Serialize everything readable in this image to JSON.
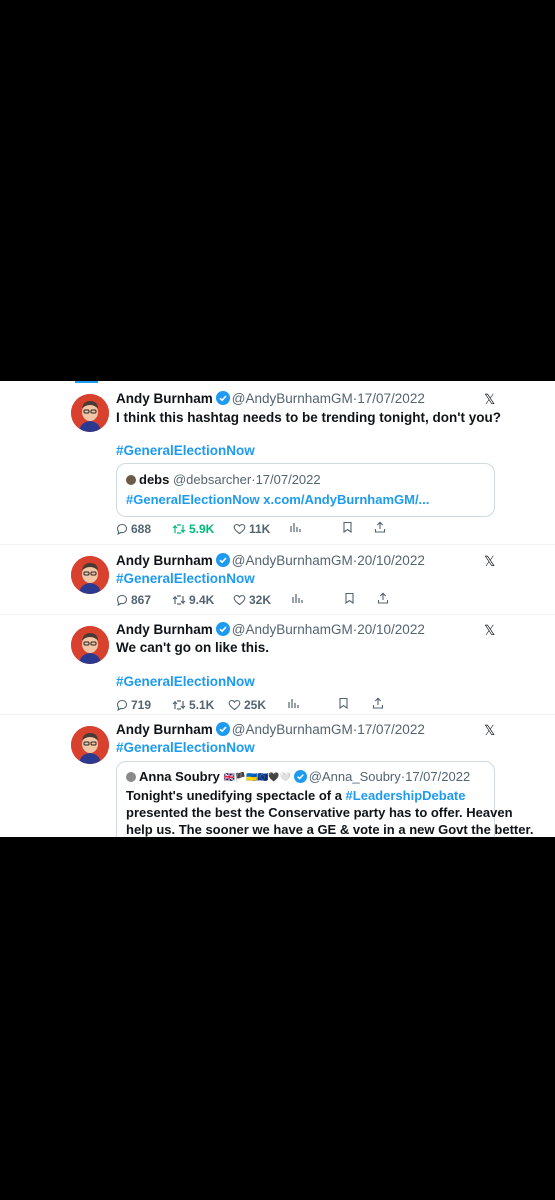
{
  "colors": {
    "accent": "#1d9bf0",
    "retweet_green": "#00ba7c",
    "avatar_bg": "#d9412f"
  },
  "tweets": [
    {
      "author_name": "Andy Burnham",
      "author_handle": "@AndyBurnhamGM",
      "date": "17/07/2022",
      "text": "I think this hashtag needs to be trending tonight, don't you?",
      "hashtag": "#GeneralElectionNow",
      "quote": {
        "author_name": "debs",
        "author_handle": "@debsarcher",
        "date": "17/07/2022",
        "line": "#GeneralElectionNow x.com/AndyBurnhamGM/..."
      },
      "stats": {
        "replies": "688",
        "retweets": "5.9K",
        "likes": "11K"
      }
    },
    {
      "author_name": "Andy Burnham",
      "author_handle": "@AndyBurnhamGM",
      "date": "20/10/2022",
      "hashtag": "#GeneralElectionNow",
      "stats": {
        "replies": "867",
        "retweets": "9.4K",
        "likes": "32K"
      }
    },
    {
      "author_name": "Andy Burnham",
      "author_handle": "@AndyBurnhamGM",
      "date": "20/10/2022",
      "text": "We can't go on like this.",
      "hashtag": "#GeneralElectionNow",
      "stats": {
        "replies": "719",
        "retweets": "5.1K",
        "likes": "25K"
      }
    },
    {
      "author_name": "Andy Burnham",
      "author_handle": "@AndyBurnhamGM",
      "date": "17/07/2022",
      "hashtag": "#GeneralElectionNow",
      "quote": {
        "author_name": "Anna Soubry",
        "author_flags": "🇬🇧🏴🇺🇦🇪🇺🖤🤍",
        "author_handle": "@Anna_Soubry",
        "date": "17/07/2022",
        "line1_pre": "Tonight's unedifying spectacle of a ",
        "line1_tag": "#LeadershipDebate",
        "line2": "presented the best the Conservative party has to offer. Heaven",
        "line3": "help us. The sooner we have a GE & vote in a new Govt the better."
      }
    }
  ],
  "icons": {
    "verified": "verified-badge-icon",
    "close": "x-logo-icon",
    "reply": "reply-icon",
    "retweet": "retweet-icon",
    "like": "heart-icon",
    "views": "analytics-icon",
    "bookmark": "bookmark-icon",
    "share": "share-icon"
  },
  "glyphs": {
    "close": "𝕏",
    "dot": "·"
  }
}
